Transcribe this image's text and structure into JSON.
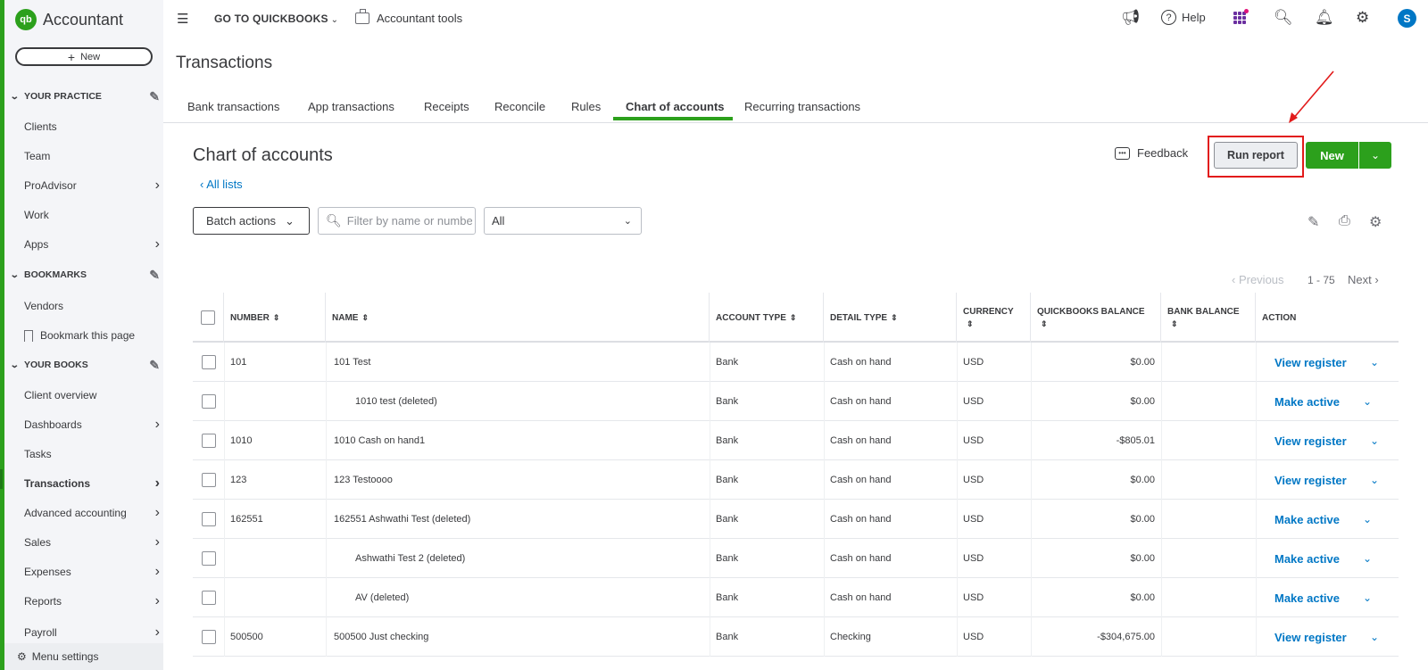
{
  "app": {
    "brand": "Accountant",
    "logo": "qb"
  },
  "sidebar": {
    "new_label": "New",
    "sections": [
      {
        "title": "YOUR PRACTICE",
        "items": [
          {
            "label": "Clients",
            "has_arrow": false
          },
          {
            "label": "Team",
            "has_arrow": false
          },
          {
            "label": "ProAdvisor",
            "has_arrow": true
          },
          {
            "label": "Work",
            "has_arrow": false
          },
          {
            "label": "Apps",
            "has_arrow": true
          }
        ]
      },
      {
        "title": "BOOKMARKS",
        "items": [
          {
            "label": "Vendors",
            "has_arrow": false
          },
          {
            "label": "Bookmark this page",
            "has_arrow": false
          }
        ]
      },
      {
        "title": "YOUR BOOKS",
        "items": [
          {
            "label": "Client overview",
            "has_arrow": false
          },
          {
            "label": "Dashboards",
            "has_arrow": true
          },
          {
            "label": "Tasks",
            "has_arrow": false
          },
          {
            "label": "Transactions",
            "has_arrow": true,
            "active": true
          },
          {
            "label": "Advanced accounting",
            "has_arrow": true
          },
          {
            "label": "Sales",
            "has_arrow": true
          },
          {
            "label": "Expenses",
            "has_arrow": true
          },
          {
            "label": "Reports",
            "has_arrow": true
          },
          {
            "label": "Payroll",
            "has_arrow": true
          }
        ]
      }
    ],
    "menu_settings": "Menu settings"
  },
  "topbar": {
    "goto": "GO TO QUICKBOOKS",
    "accountant_tools": "Accountant tools",
    "help": "Help",
    "avatar": "S"
  },
  "page": {
    "title": "Transactions",
    "tabs": [
      "Bank transactions",
      "App transactions",
      "Receipts",
      "Reconcile",
      "Rules",
      "Chart of accounts",
      "Recurring transactions"
    ],
    "active_tab": "Chart of accounts",
    "heading": "Chart of accounts",
    "all_lists": "All lists",
    "feedback": "Feedback",
    "run_report": "Run report",
    "new_button": "New",
    "batch_actions": "Batch actions",
    "filter_placeholder": "Filter by name or number",
    "type_filter": "All",
    "pager": {
      "previous": "Previous",
      "range": "1 - 75",
      "next": "Next"
    }
  },
  "table": {
    "headers": {
      "number": "NUMBER",
      "name": "NAME",
      "account_type": "ACCOUNT TYPE",
      "detail_type": "DETAIL TYPE",
      "currency": "CURRENCY",
      "qb_balance": "QUICKBOOKS BALANCE",
      "bank_balance": "BANK BALANCE",
      "action": "ACTION"
    },
    "rows": [
      {
        "number": "101",
        "name": "101 Test",
        "indent": false,
        "account_type": "Bank",
        "detail_type": "Cash on hand",
        "currency": "USD",
        "qb_balance": "$0.00",
        "bank_balance": "",
        "action": "View register"
      },
      {
        "number": "",
        "name": "1010 test (deleted)",
        "indent": true,
        "account_type": "Bank",
        "detail_type": "Cash on hand",
        "currency": "USD",
        "qb_balance": "$0.00",
        "bank_balance": "",
        "action": "Make active"
      },
      {
        "number": "1010",
        "name": "1010 Cash on hand1",
        "indent": false,
        "account_type": "Bank",
        "detail_type": "Cash on hand",
        "currency": "USD",
        "qb_balance": "-$805.01",
        "bank_balance": "",
        "action": "View register"
      },
      {
        "number": "123",
        "name": "123 Testoooo",
        "indent": false,
        "account_type": "Bank",
        "detail_type": "Cash on hand",
        "currency": "USD",
        "qb_balance": "$0.00",
        "bank_balance": "",
        "action": "View register"
      },
      {
        "number": "162551",
        "name": "162551 Ashwathi Test (deleted)",
        "indent": false,
        "account_type": "Bank",
        "detail_type": "Cash on hand",
        "currency": "USD",
        "qb_balance": "$0.00",
        "bank_balance": "",
        "action": "Make active"
      },
      {
        "number": "",
        "name": "Ashwathi Test 2 (deleted)",
        "indent": true,
        "account_type": "Bank",
        "detail_type": "Cash on hand",
        "currency": "USD",
        "qb_balance": "$0.00",
        "bank_balance": "",
        "action": "Make active"
      },
      {
        "number": "",
        "name": "AV (deleted)",
        "indent": true,
        "account_type": "Bank",
        "detail_type": "Cash on hand",
        "currency": "USD",
        "qb_balance": "$0.00",
        "bank_balance": "",
        "action": "Make active"
      },
      {
        "number": "500500",
        "name": "500500 Just checking",
        "indent": false,
        "account_type": "Bank",
        "detail_type": "Checking",
        "currency": "USD",
        "qb_balance": "-$304,675.00",
        "bank_balance": "",
        "action": "View register"
      }
    ]
  },
  "colors": {
    "brand_green": "#2ca01c",
    "link_blue": "#0077c5",
    "highlight_red": "#e21b1b"
  }
}
